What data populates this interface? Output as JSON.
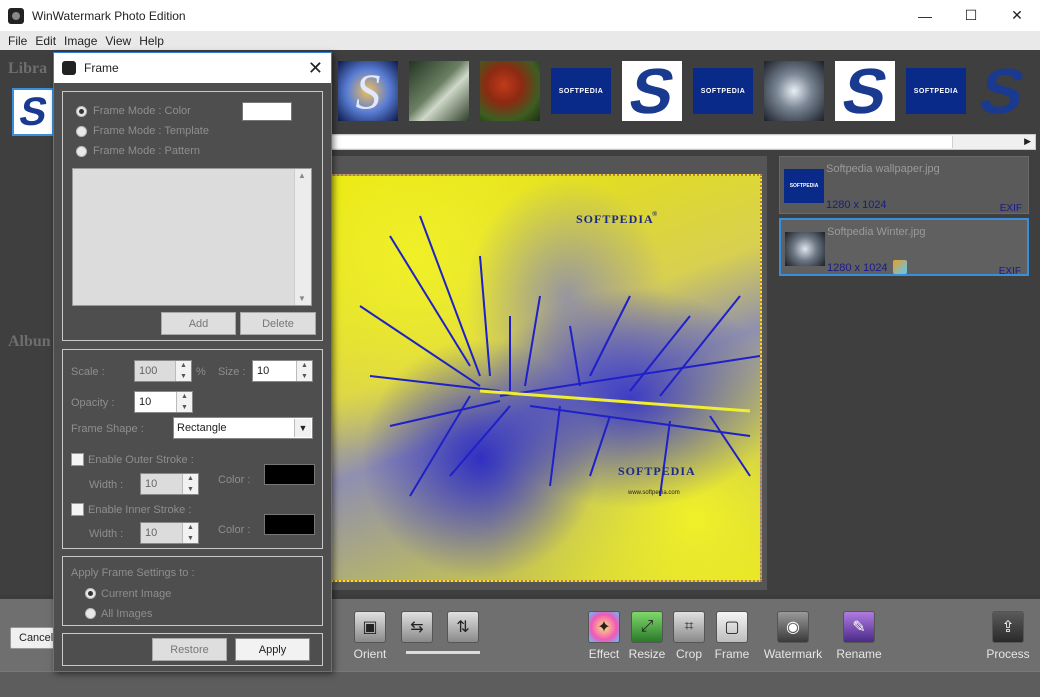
{
  "window": {
    "title": "WinWatermark Photo Edition",
    "minimize": "—",
    "maximize": "☐",
    "close": "✕"
  },
  "menu": [
    "File",
    "Edit",
    "Image",
    "View",
    "Help"
  ],
  "sidebar": {
    "library_label": "Libra",
    "album_label": "Albun"
  },
  "thumb_strip": {
    "items": [
      {
        "kind": "fire",
        "glyph": "S"
      },
      {
        "kind": "forest"
      },
      {
        "kind": "autumn"
      },
      {
        "kind": "blue-logo",
        "text": "SOFTPEDIA"
      },
      {
        "kind": "s-logo",
        "glyph": "S"
      },
      {
        "kind": "blue-logo",
        "text": "SOFTPEDIA"
      },
      {
        "kind": "winter"
      },
      {
        "kind": "s-logo",
        "glyph": "S"
      },
      {
        "kind": "blue-logo",
        "text": "SOFTPEDIA"
      },
      {
        "kind": "s-logo",
        "glyph": "S"
      }
    ],
    "scroll_right_arrow": "▶"
  },
  "preview": {
    "watermark_top": "SOFTPEDIA",
    "watermark_mark": "®",
    "watermark_bottom": "SOFTPEDIA",
    "watermark_url": "www.softpedia.com"
  },
  "files": [
    {
      "name": "Softpedia wallpaper.jpg",
      "dims": "1280 x 1024",
      "exif": "EXIF",
      "selected": false,
      "thumb_text": "SOFTPEDIA"
    },
    {
      "name": "Softpedia Winter.jpg",
      "dims": "1280 x 1024",
      "exif": "EXIF",
      "selected": true
    }
  ],
  "toolbar": {
    "cancel_label": "Cancel",
    "orient_label": "Orient",
    "tools": [
      {
        "id": "effect",
        "label": "Effect",
        "icon": "✦"
      },
      {
        "id": "resize",
        "label": "Resize",
        "icon": "⤢"
      },
      {
        "id": "crop",
        "label": "Crop",
        "icon": "⌗"
      },
      {
        "id": "frame",
        "label": "Frame",
        "icon": "▢"
      },
      {
        "id": "watermark",
        "label": "Watermark",
        "icon": "◉"
      },
      {
        "id": "rename",
        "label": "Rename",
        "icon": "✎"
      },
      {
        "id": "process",
        "label": "Process",
        "icon": "⇪"
      }
    ]
  },
  "dialog": {
    "title": "Frame",
    "close": "✕",
    "mode_color": "Frame Mode : Color",
    "mode_template": "Frame Mode : Template",
    "mode_pattern": "Frame Mode : Pattern",
    "add": "Add",
    "delete": "Delete",
    "scale_label": "Scale :",
    "scale_value": "100",
    "percent": "%",
    "size_label": "Size :",
    "size_value": "10",
    "opacity_label": "Opacity :",
    "opacity_value": "10",
    "shape_label": "Frame Shape :",
    "shape_value": "Rectangle",
    "outer_stroke": "Enable Outer Stroke :",
    "outer_width_label": "Width :",
    "outer_width_value": "10",
    "outer_color_label": "Color :",
    "inner_stroke": "Enable Inner Stroke :",
    "inner_width_label": "Width :",
    "inner_width_value": "10",
    "inner_color_label": "Color :",
    "apply_to_label": "Apply Frame Settings to :",
    "current_image": "Current Image",
    "all_images": "All Images",
    "restore": "Restore",
    "apply": "Apply"
  }
}
